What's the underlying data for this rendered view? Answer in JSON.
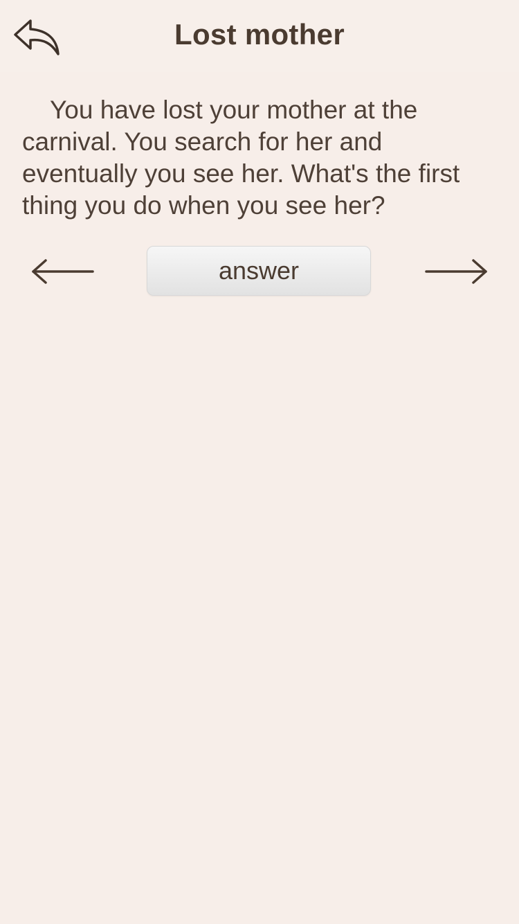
{
  "header": {
    "title": "Lost mother",
    "back_icon": "back-reply-arrow-icon"
  },
  "question": {
    "text": "You have lost your mother at the carnival. You search for her and eventually you see her. What's the first thing you do when you see her?"
  },
  "controls": {
    "prev_icon": "arrow-left-icon",
    "next_icon": "arrow-right-icon",
    "answer_label": "answer"
  },
  "colors": {
    "background": "#f7eee9",
    "text": "#4a3b30",
    "button_bg": "#e8e8e8"
  }
}
